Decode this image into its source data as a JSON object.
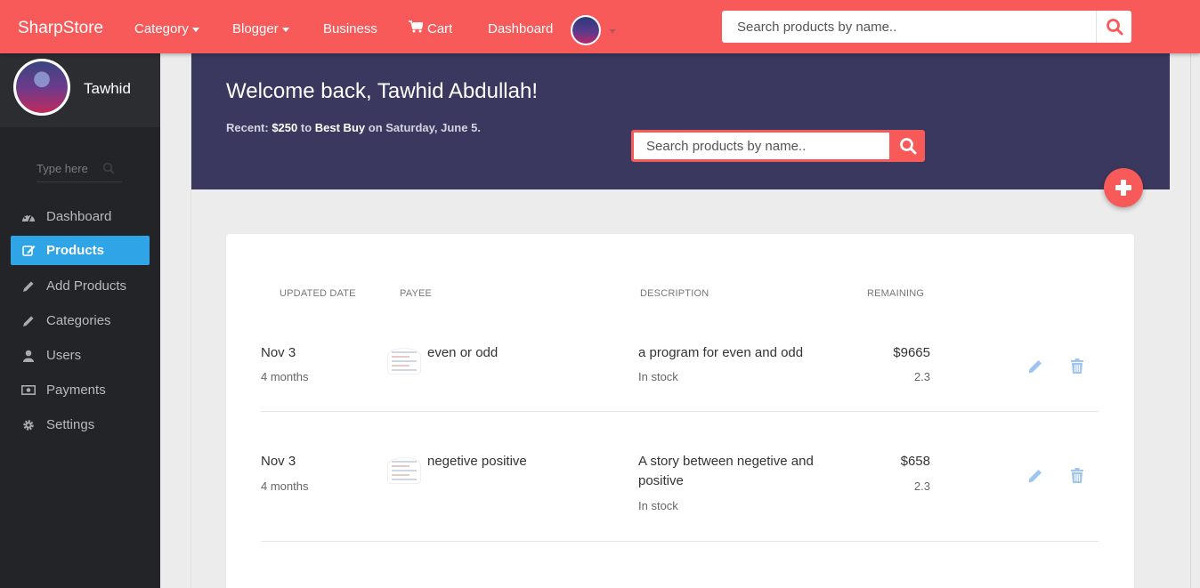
{
  "nav": {
    "brand": "SharpStore",
    "items": [
      {
        "label": "Category",
        "has_caret": true
      },
      {
        "label": "Blogger",
        "has_caret": true
      },
      {
        "label": "Business",
        "has_caret": false
      },
      {
        "label": "Cart",
        "icon": "cart-icon"
      },
      {
        "label": "Dashboard",
        "has_caret": false
      }
    ],
    "search_placeholder": "Search products by name.."
  },
  "sidebar": {
    "user_name": "Tawhid",
    "search_placeholder": "Type here",
    "items": [
      {
        "label": "Dashboard",
        "icon": "dashboard-icon",
        "active": false
      },
      {
        "label": "Products",
        "icon": "edit-icon",
        "active": true
      },
      {
        "label": "Add Products",
        "icon": "pencil-icon",
        "active": false
      },
      {
        "label": "Categories",
        "icon": "pencil-icon",
        "active": false
      },
      {
        "label": "Users",
        "icon": "user-icon",
        "active": false
      },
      {
        "label": "Payments",
        "icon": "money-icon",
        "active": false
      },
      {
        "label": "Settings",
        "icon": "gear-icon",
        "active": false
      }
    ]
  },
  "banner": {
    "welcome": "Welcome back, Tawhid Abdullah!",
    "recent_prefix": "Recent:",
    "recent_amount": "$250",
    "recent_to": "to",
    "recent_payee": "Best Buy",
    "recent_suffix": "on Saturday, June 5.",
    "search_placeholder": "Search products by name.."
  },
  "table": {
    "headers": {
      "date": "UPDATED DATE",
      "payee": "PAYEE",
      "description": "DESCRIPTION",
      "remaining": "REMAINING"
    },
    "rows": [
      {
        "date": "Nov 3",
        "age": "4 months",
        "payee": "even or odd",
        "description": "a program for even and odd",
        "status": "In stock",
        "price": "$9665",
        "rating": "2.3"
      },
      {
        "date": "Nov 3",
        "age": "4 months",
        "payee": "negetive positive",
        "description": "A story between negetive and positive",
        "status": "In stock",
        "price": "$658",
        "rating": "2.3"
      }
    ]
  },
  "colors": {
    "primary": "#f85a5a",
    "sidebar": "#222427",
    "active": "#2fa4e7",
    "banner": "#3b385f",
    "action_icon": "#9ec5ef"
  }
}
